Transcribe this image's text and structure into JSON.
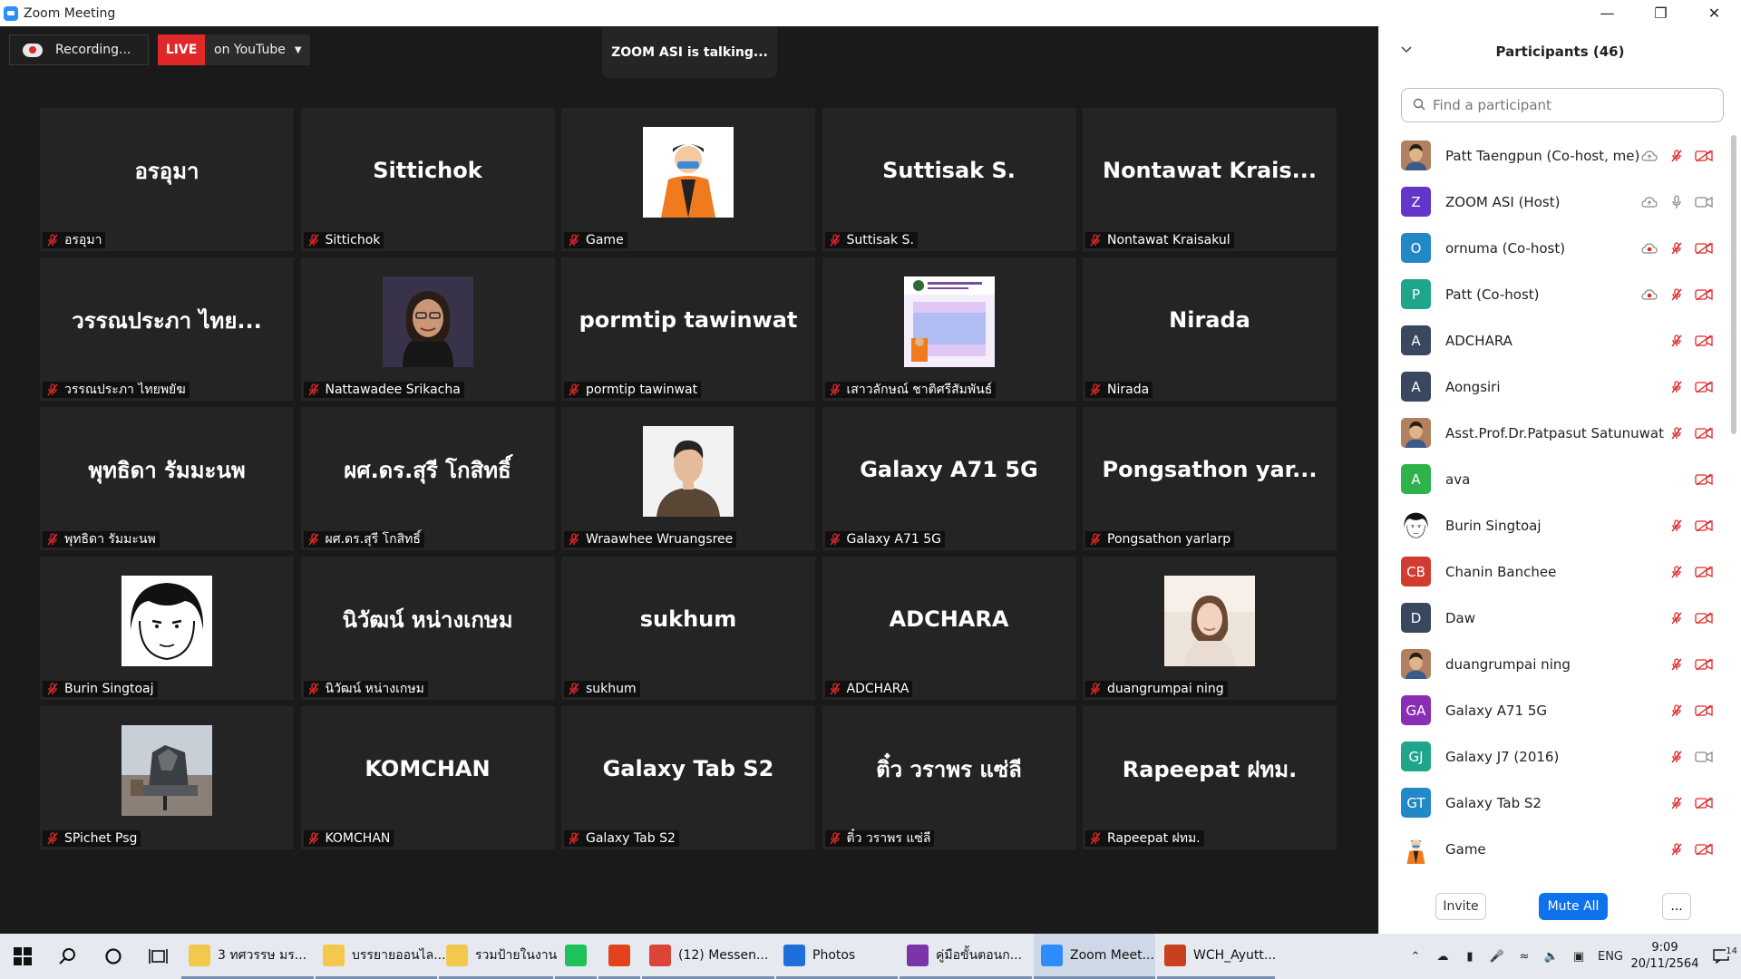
{
  "window": {
    "title": "Zoom Meeting"
  },
  "recording": {
    "label": "Recording...",
    "live": "LIVE",
    "destination": "on YouTube"
  },
  "talking": "ZOOM ASI is talking...",
  "tiles": [
    {
      "big": "อรอุมา",
      "label": "อรอุมา"
    },
    {
      "big": "Sittichok",
      "label": "Sittichok"
    },
    {
      "big": "",
      "label": "Game",
      "pic": "game"
    },
    {
      "big": "Suttisak S.",
      "label": "Suttisak S."
    },
    {
      "big": "Nontawat  Krais...",
      "label": "Nontawat Kraisakul"
    },
    {
      "big": "วรรณประภา ไทย...",
      "label": "วรรณประภา ไทยพยัฆ"
    },
    {
      "big": "",
      "label": "Nattawadee Srikacha",
      "pic": "woman"
    },
    {
      "big": "pormtip tawinwat",
      "label": "pormtip tawinwat"
    },
    {
      "big": "",
      "label": "เสาวลักษณ์ ชาติศรีสัมพันธ์",
      "pic": "science"
    },
    {
      "big": "Nirada",
      "label": "Nirada"
    },
    {
      "big": "พุทธิดา รัมมะนพ",
      "label": "พุทธิดา รัมมะนพ"
    },
    {
      "big": "ผศ.ดร.สุรี โกสิทธิ์",
      "label": "ผศ.ดร.สุรี โกสิทธิ์"
    },
    {
      "big": "",
      "label": "Wraawhee Wruangsree",
      "pic": "man"
    },
    {
      "big": "Galaxy A71 5G",
      "label": "Galaxy A71 5G"
    },
    {
      "big": "Pongsathon  yar...",
      "label": "Pongsathon yarlarp"
    },
    {
      "big": "",
      "label": "Burin Singtoaj",
      "pic": "sketch"
    },
    {
      "big": "นิวัฒน์ หน่างเกษม",
      "label": "นิวัฒน์ หน่างเกษม"
    },
    {
      "big": "sukhum",
      "label": "sukhum"
    },
    {
      "big": "ADCHARA",
      "label": "ADCHARA"
    },
    {
      "big": "",
      "label": "duangrumpai ning",
      "pic": "girl"
    },
    {
      "big": "",
      "label": "SPichet Psg",
      "pic": "statue"
    },
    {
      "big": "KOMCHAN",
      "label": "KOMCHAN"
    },
    {
      "big": "Galaxy Tab S2",
      "label": "Galaxy Tab S2"
    },
    {
      "big": "ติ๋ว วราพร แซ่ลี",
      "label": "ติ๋ว วราพร แซ่ลี"
    },
    {
      "big": "Rapeepat ฝทม.",
      "label": "Rapeepat ฝทม."
    }
  ],
  "panel": {
    "title": "Participants (46)",
    "search_placeholder": "Find a participant",
    "invite": "Invite",
    "mute_all": "Mute All",
    "more": "..."
  },
  "participants": [
    {
      "name": "Patt Taengpun (Co-host, me)",
      "initials": "",
      "color": "#7a5b3a",
      "pic": "photo",
      "cloud": true,
      "mic": "off",
      "vid": "off"
    },
    {
      "name": "ZOOM ASI (Host)",
      "initials": "Z",
      "color": "#6236c9",
      "cloud": true,
      "mic": "on",
      "vid": "on"
    },
    {
      "name": "ornuma (Co-host)",
      "initials": "O",
      "color": "#2389c6",
      "cloud": true,
      "rec": true,
      "mic": "off",
      "vid": "off"
    },
    {
      "name": "Patt (Co-host)",
      "initials": "P",
      "color": "#1fa58a",
      "cloud": true,
      "rec": true,
      "mic": "off",
      "vid": "off"
    },
    {
      "name": "ADCHARA",
      "initials": "A",
      "color": "#39475f",
      "mic": "off",
      "vid": "off"
    },
    {
      "name": "Aongsiri",
      "initials": "A",
      "color": "#39475f",
      "mic": "off",
      "vid": "off"
    },
    {
      "name": "Asst.Prof.Dr.Patpasut Satunuwat",
      "initials": "",
      "color": "#c9562c",
      "pic": "photo",
      "mic": "off",
      "vid": "off"
    },
    {
      "name": "ava",
      "initials": "A",
      "color": "#2db34a",
      "mic": "",
      "vid": "off"
    },
    {
      "name": "Burin Singtoaj",
      "initials": "",
      "color": "#ffffff",
      "pic": "sketch",
      "mic": "off",
      "vid": "off"
    },
    {
      "name": "Chanin Banchee",
      "initials": "CB",
      "color": "#d23b2f",
      "mic": "off",
      "vid": "off"
    },
    {
      "name": "Daw",
      "initials": "D",
      "color": "#39475f",
      "mic": "off",
      "vid": "off"
    },
    {
      "name": "duangrumpai ning",
      "initials": "",
      "color": "#e8d4c4",
      "pic": "photo",
      "mic": "off",
      "vid": "off"
    },
    {
      "name": "Galaxy A71 5G",
      "initials": "GA",
      "color": "#8a2fb5",
      "mic": "off",
      "vid": "off"
    },
    {
      "name": "Galaxy J7 (2016)",
      "initials": "GJ",
      "color": "#1fa58a",
      "mic": "off",
      "vid": "on"
    },
    {
      "name": "Galaxy Tab S2",
      "initials": "GT",
      "color": "#2389c6",
      "mic": "off",
      "vid": "off"
    },
    {
      "name": "Game",
      "initials": "",
      "color": "#ffffff",
      "pic": "game",
      "mic": "off",
      "vid": "off"
    }
  ],
  "taskbar": {
    "apps": [
      {
        "label": "3 ทศวรรษ มร...",
        "color": "#f2c94c"
      },
      {
        "label": "บรรยายออนไล...",
        "color": "#f2c94c"
      },
      {
        "label": "รวมป้ายในงาน",
        "color": "#f2c94c"
      },
      {
        "label": "",
        "color": "#1ec25a",
        "icon": "line"
      },
      {
        "label": "",
        "color": "#e3421d",
        "icon": "office"
      },
      {
        "label": "(12) Messen...",
        "color": "#db4437"
      },
      {
        "label": "Photos",
        "color": "#1e6fd9"
      },
      {
        "label": "คู่มือขั้นตอนก...",
        "color": "#7b35a8"
      },
      {
        "label": "Zoom Meet...",
        "color": "#2d8cff",
        "active": true
      },
      {
        "label": "WCH_Ayutt...",
        "color": "#c9401f"
      }
    ],
    "lang": "ENG",
    "time": "9:09",
    "date": "20/11/2564",
    "notif_count": "14"
  },
  "colors": {
    "accent": "#0e72ed",
    "live": "#e02828",
    "mic_off": "#e02828"
  }
}
